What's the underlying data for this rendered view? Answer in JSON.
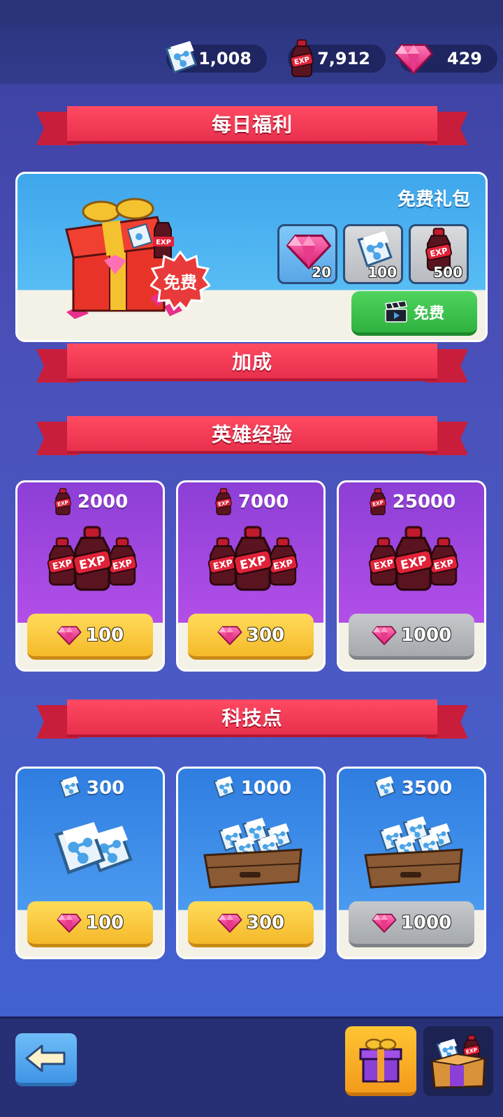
{
  "currencies": {
    "tech_points": "1,008",
    "exp": "7,912",
    "gems": "429"
  },
  "sections": {
    "daily": "每日福利",
    "boost": "加成",
    "hero_exp": "英雄经验",
    "tech": "科技点"
  },
  "daily_card": {
    "badge": "免费",
    "title": "免费礼包",
    "rewards": [
      {
        "icon": "gem-icon",
        "value": "20"
      },
      {
        "icon": "tech-point-icon",
        "value": "100"
      },
      {
        "icon": "exp-bottle-icon",
        "value": "500"
      }
    ],
    "button_label": "免费",
    "button_icon": "video-clapper-icon"
  },
  "exp_offers": [
    {
      "amount": "2000",
      "price": "100",
      "state": "affordable"
    },
    {
      "amount": "7000",
      "price": "300",
      "state": "affordable"
    },
    {
      "amount": "25000",
      "price": "1000",
      "state": "unaffordable"
    }
  ],
  "tech_offers": [
    {
      "amount": "300",
      "price": "100",
      "state": "affordable"
    },
    {
      "amount": "1000",
      "price": "300",
      "state": "affordable"
    },
    {
      "amount": "3500",
      "price": "1000",
      "state": "unaffordable"
    }
  ],
  "bottom_nav": {
    "back_icon": "arrow-left-icon",
    "tabs": [
      "gift-tab",
      "shop-tab"
    ]
  },
  "colors": {
    "ribbon": "#e8304c",
    "exp_card": "#b24fe8",
    "tech_card": "#4b9af0",
    "price_gold": "#f5b92a",
    "price_gray": "#a5a9ad",
    "free_green": "#2fb23f"
  }
}
